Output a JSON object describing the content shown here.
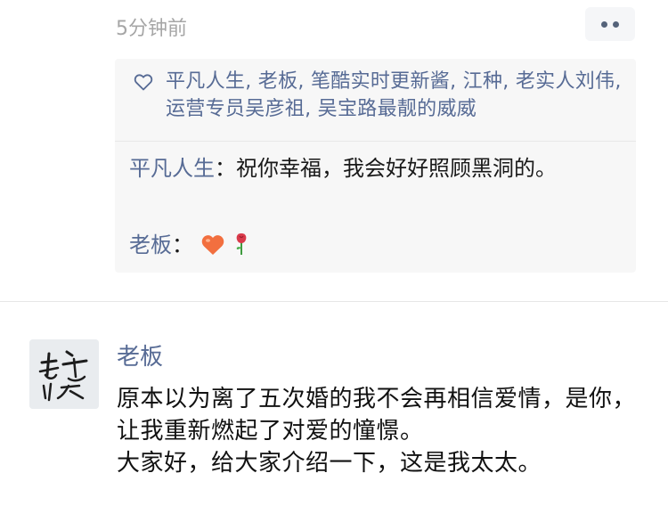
{
  "post_header": {
    "timestamp": "5分钟前",
    "more_icon": "more-dots-icon"
  },
  "likes": {
    "icon": "heart-outline-icon",
    "names": "平凡人生, 老板, 笔酷实时更新酱, 江种, 老实人刘伟, 运营专员吴彦祖, 吴宝路最靓的威威"
  },
  "comments": [
    {
      "author": "平凡人生",
      "separator": "：",
      "text": "祝你幸福，我会好好照顾黑洞的。"
    },
    {
      "author": "老板",
      "separator": "：",
      "emojis": [
        "heart-emoji",
        "rose-emoji"
      ]
    }
  ],
  "next_post": {
    "username": "老板",
    "avatar": "calligraphy-avatar",
    "lines": [
      "原本以为离了五次婚的我不会再相信爱情，是你，让我重新燃起了对爱的憧憬。",
      "大家好，给大家介绍一下，这是我太太。"
    ]
  },
  "colors": {
    "link": "#576b95",
    "timestamp": "#a6a6a6",
    "comment_bg": "#f7f7f7",
    "text": "#111111"
  }
}
